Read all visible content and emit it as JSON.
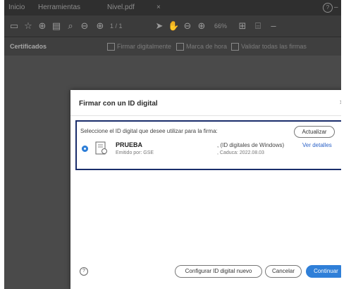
{
  "menubar": {
    "home": "Inicio",
    "tools": "Herramientas",
    "document": "Nivel.pdf",
    "document_close": "×",
    "help": "?",
    "minimize": "–"
  },
  "toolbar": {
    "page_display": "1 / 1",
    "zoom": "66%"
  },
  "cert_toolbar": {
    "title": "Certificados",
    "sign_action": "Firmar digitalmente",
    "timestamp_action": "Marca de hora",
    "validate_action": "Validar todas las firmas"
  },
  "dialog": {
    "title": "Firmar con un ID digital",
    "close": "×",
    "prompt": "Seleccione el ID digital que desee utilizar para la firma:",
    "refresh_button": "Actualizar",
    "certificate": {
      "name": "PRUEBA",
      "issuer": "Emitido por: GSE",
      "type": ", (ID digitales de Windows)",
      "expiry": ", Caduca: 2022.08.03",
      "details_link": "Ver detalles"
    },
    "help_icon": "?",
    "buttons": {
      "configure": "Configurar ID digital nuevo",
      "cancel": "Cancelar",
      "continue": "Continuar"
    }
  },
  "colors": {
    "accent": "#2f7fd8",
    "highlight_border": "#1a2d6b"
  }
}
